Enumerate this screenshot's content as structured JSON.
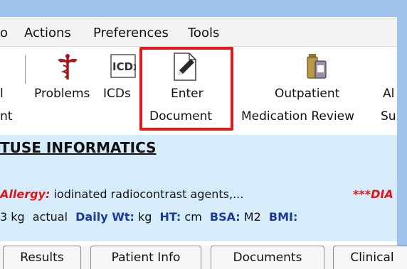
{
  "menu": {
    "items": [
      "o",
      "Actions",
      "Preferences",
      "Tools"
    ]
  },
  "toolbar": {
    "partial_left_line1": "l",
    "partial_left_line2": "nt",
    "problems_label": "Problems",
    "icds_label": "ICDs",
    "icds_icon_text": "ICDx",
    "enter_document_line1": "Enter",
    "enter_document_line2": "Document",
    "outpatient_line1": "Outpatient",
    "outpatient_line2": "Medication Review",
    "partial_right_line1": "Al",
    "partial_right_line2": "Su"
  },
  "banner": {
    "patient_name": "TUSE INFORMATICS",
    "allergy_label": "Allergy:",
    "allergy_value": " iodinated radiocontrast agents,...",
    "diagnosis_flag": "***DIA",
    "vitals": {
      "weight_value": "3 kg",
      "weight_type": "actual",
      "daily_wt_label": "Daily Wt:",
      "daily_wt_unit": "kg",
      "ht_label": "HT:",
      "ht_unit": "cm",
      "bsa_label": "BSA:",
      "bsa_unit": "M2",
      "bmi_label": "BMI:"
    }
  },
  "tabs": [
    "Results",
    "Patient Info",
    "Documents",
    "Clinical"
  ],
  "colors": {
    "highlight": "#e21a1a",
    "banner_bg": "#d7ecfa",
    "allergy": "#e01616",
    "label_blue": "#1a3a9a"
  }
}
